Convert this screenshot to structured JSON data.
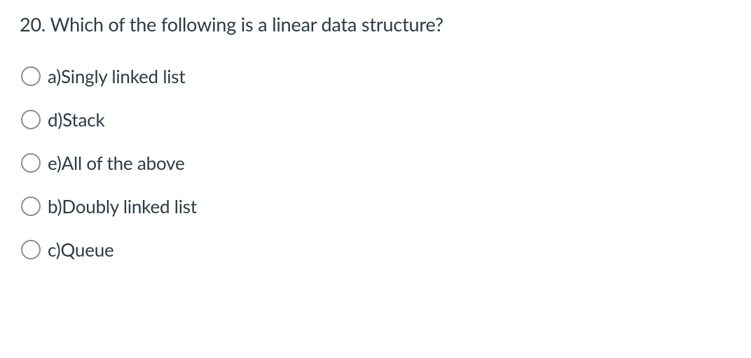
{
  "question": {
    "number": "20.",
    "text": "Which of the following is a linear data structure?"
  },
  "options": [
    {
      "label": "a)Singly linked list"
    },
    {
      "label": "d)Stack"
    },
    {
      "label": "e)All of the above"
    },
    {
      "label": "b)Doubly linked list"
    },
    {
      "label": "c)Queue"
    }
  ]
}
